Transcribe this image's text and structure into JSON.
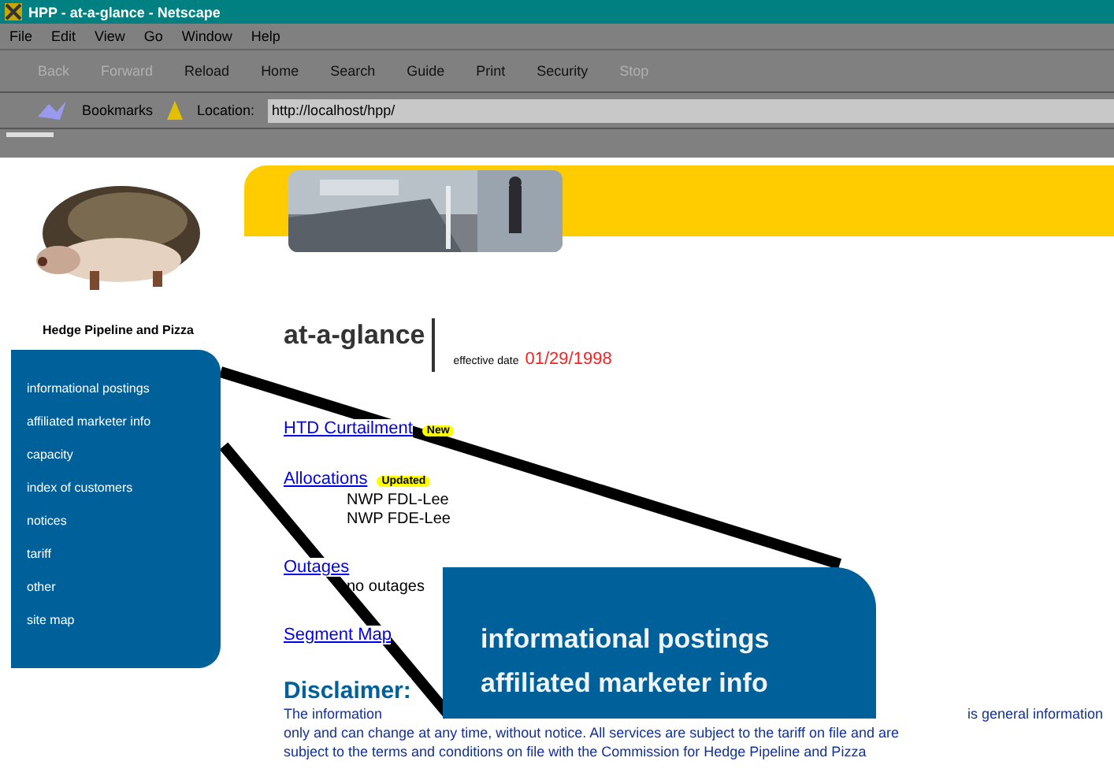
{
  "window": {
    "title": "HPP - at-a-glance - Netscape"
  },
  "menu": [
    "File",
    "Edit",
    "View",
    "Go",
    "Window",
    "Help"
  ],
  "toolbar": [
    {
      "label": "Back",
      "disabled": true
    },
    {
      "label": "Forward",
      "disabled": true
    },
    {
      "label": "Reload",
      "disabled": false
    },
    {
      "label": "Home",
      "disabled": false
    },
    {
      "label": "Search",
      "disabled": false
    },
    {
      "label": "Guide",
      "disabled": false
    },
    {
      "label": "Print",
      "disabled": false
    },
    {
      "label": "Security",
      "disabled": false
    },
    {
      "label": "Stop",
      "disabled": true
    }
  ],
  "location_bar": {
    "bookmarks": "Bookmarks",
    "label": "Location:",
    "url": "http://localhost/hpp/"
  },
  "sidebar": {
    "company": "Hedge Pipeline and Pizza",
    "items": [
      "informational postings",
      "affiliated marketer info",
      "capacity",
      "index of customers",
      "notices",
      "tariff",
      "other",
      "site map"
    ]
  },
  "main": {
    "heading": "at-a-glance",
    "effective_label": "effective date",
    "effective_date": "01/29/1998",
    "sections": [
      {
        "link": "HTD Curtailment",
        "badge": "New"
      },
      {
        "link": "Allocations",
        "badge": "Updated",
        "lines": [
          "NWP FDL-Lee",
          "NWP FDE-Lee"
        ]
      },
      {
        "link": "Outages",
        "lines": [
          "no outages"
        ]
      },
      {
        "link": "Segment Map"
      }
    ],
    "disclaimer_title": "Disclaimer:",
    "disclaimer_lines": [
      {
        "left": "The information",
        "right": "is general information"
      },
      {
        "left": "only and can change at any time, without notice. All services are subject to the tariff on file and are"
      },
      {
        "left": "subject to the terms and conditions on file with the Commission for Hedge Pipeline and Pizza"
      }
    ]
  },
  "callout": {
    "items": [
      "informational postings",
      "affiliated marketer info"
    ]
  }
}
